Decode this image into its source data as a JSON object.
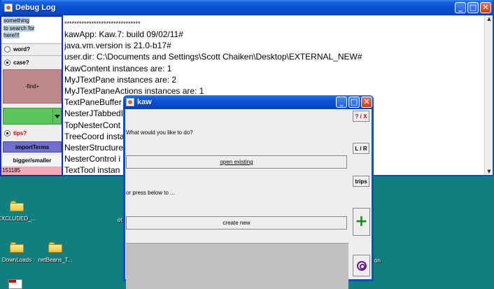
{
  "debug_window": {
    "title": "Debug Log",
    "log_lines": [
      "*******************************",
      "kawApp: Kaw.7: build 09/02/11#",
      "java.vm.version is 21.0-b17#",
      "user.dir: C:\\Documents and Settings\\Scott Chaiken\\Desktop\\EXTERNAL_NEW#",
      "KawContent instances are: 1",
      "MyJTextPane instances are: 2",
      "MyJTextPaneActions instances are: 1",
      "TextPaneBuffer",
      "NesterJTabbedI",
      "TopNesterCont",
      "TreeCoord insta",
      "NesterStructure",
      "NesterControl i",
      "TextTool instan"
    ]
  },
  "side_panel": {
    "search_text": [
      "something",
      "to search for",
      "here!!!"
    ],
    "word_label": "word?",
    "case_label": "case?",
    "find_label": "-find+",
    "tips_label": "tips?",
    "import_label": "importTerms",
    "bigger_label": "bigger/smaller",
    "count": "151185",
    "word_checked": false,
    "case_checked": true,
    "tips_checked": true,
    "colors": {
      "find": "#c08989",
      "combo": "#5cc45c",
      "import": "#6f6fd0",
      "count": "#f4a9b8"
    }
  },
  "kaw_dialog": {
    "title": "kaw",
    "question": "What would you like to do?",
    "open_button": "open existing",
    "or_text": "or press below to ...",
    "create_button": "create new",
    "help_button": "? / X",
    "lr_button": "L / R",
    "trips_button": "trips",
    "plus_icon": "plus-icon",
    "target_icon": "target-icon"
  },
  "desktop": {
    "icons": [
      {
        "label": "EXCLUDED_...",
        "icon": "folder-icon"
      },
      {
        "label": "DownLoads",
        "icon": "folder-icon"
      },
      {
        "label": "netBeans_T...",
        "icon": "folder-icon"
      }
    ],
    "fragments": {
      "ot": "ot",
      "on": "on"
    }
  },
  "window_buttons": {
    "minimize": "_",
    "maximize": "□",
    "close": "✕"
  }
}
